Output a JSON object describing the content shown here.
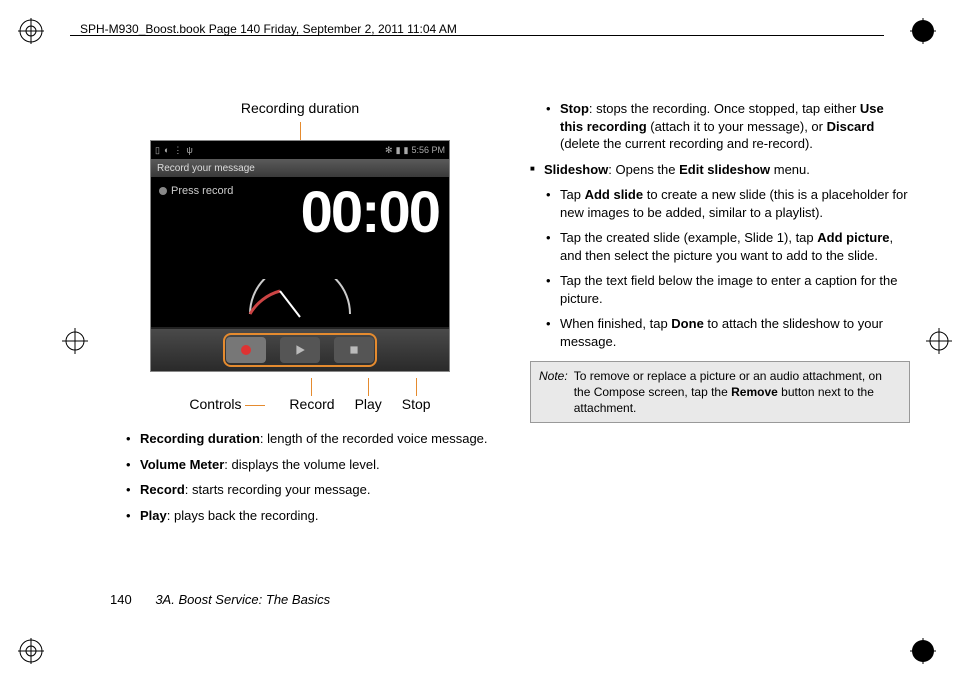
{
  "header": "SPH-M930_Boost.book  Page 140  Friday, September 2, 2011  11:04 AM",
  "figure": {
    "top_label": "Recording duration",
    "status_time": "5:56 PM",
    "titlebar": "Record your message",
    "press_record": "Press record",
    "timer": "00:00",
    "callouts": {
      "controls": "Controls",
      "record": "Record",
      "play": "Play",
      "stop": "Stop"
    }
  },
  "left_bullets": [
    {
      "term": "Recording duration",
      "text": ": length of the recorded voice message."
    },
    {
      "term": "Volume Meter",
      "text": ": displays the volume level."
    },
    {
      "term": "Record",
      "text": ": starts recording your message."
    },
    {
      "term": "Play",
      "text": ": plays back the recording."
    }
  ],
  "right": {
    "stop": {
      "term": "Stop",
      "lead": ": stops the recording. Once stopped, tap either ",
      "opt1": "Use this recording",
      "mid": " (attach it to your message), or ",
      "opt2": "Discard",
      "tail": " (delete the current recording and re-record)."
    },
    "slideshow_head": {
      "term": "Slideshow",
      "text": ": Opens the ",
      "menu": "Edit slideshow",
      "tail": " menu."
    },
    "slide_items": [
      {
        "pre": "Tap ",
        "b": "Add slide",
        "post": " to create a new slide (this is a placeholder for new images to be added, similar to a playlist)."
      },
      {
        "pre": "Tap the created slide (example, Slide 1), tap ",
        "b": "Add picture",
        "post": ", and then select the picture you want to add to the slide."
      },
      {
        "pre": "Tap the text field below the image to enter a caption for the picture.",
        "b": "",
        "post": ""
      },
      {
        "pre": "When finished, tap ",
        "b": "Done",
        "post": " to attach the slideshow to your message."
      }
    ]
  },
  "note": {
    "label": "Note:",
    "text_a": "To remove or replace a picture or an audio attachment, on the Compose screen, tap the ",
    "b": "Remove",
    "text_b": " button next to the attachment."
  },
  "footer": {
    "page": "140",
    "section": "3A. Boost Service: The Basics"
  }
}
